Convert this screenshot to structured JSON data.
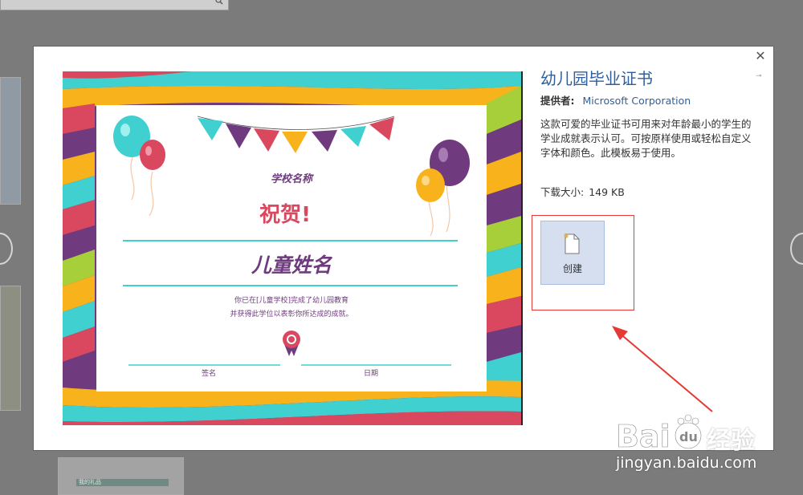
{
  "template": {
    "title": "幼儿园毕业证书",
    "provider_label": "提供者:",
    "provider_value": "Microsoft Corporation",
    "description": "这款可爱的毕业证书可用来对年龄最小的学生的学业成就表示认可。可按原样使用或轻松自定义字体和颜色。此模板易于使用。",
    "size_label": "下载大小:",
    "size_value": "149 KB",
    "create_label": "创建"
  },
  "certificate": {
    "school_name": "学校名称",
    "congrats": "祝贺!",
    "child_name": "儿童姓名",
    "line1": "你已在[儿童学校]完成了幼儿园教育",
    "line2": "并获得此学位以表彰你所达成的成就。",
    "signature_label": "签名",
    "date_label": "日期"
  },
  "background": {
    "thumb_text": "我的礼品"
  },
  "watermark": {
    "brand_text": "经验",
    "url": "jingyan.baidu.com"
  },
  "colors": {
    "accent_blue": "#2f5e9b",
    "highlight_red": "#e53935",
    "cert_purple": "#6f3b7e",
    "cert_pink": "#d9485e",
    "cert_teal": "#3fd0cf",
    "cert_yellow": "#f8b31c",
    "cert_green": "#a7cf3a"
  },
  "icons": [
    "close-icon",
    "pin-icon",
    "new-document-icon",
    "search-icon",
    "chevron-left-icon",
    "chevron-right-icon"
  ]
}
